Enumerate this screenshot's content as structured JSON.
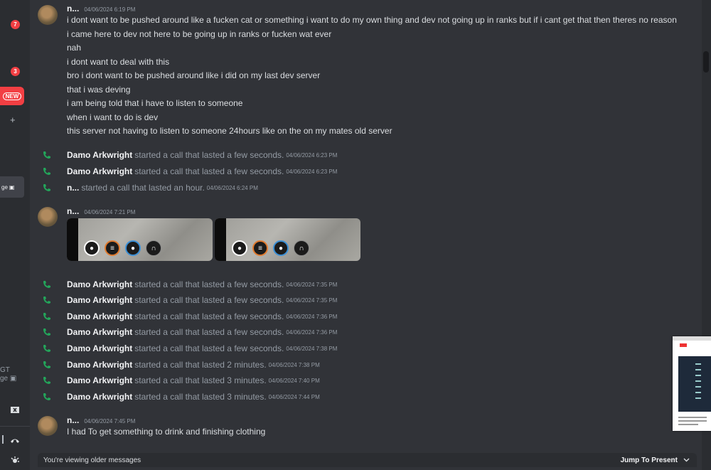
{
  "sidebar": {
    "badges": [
      "7",
      "3"
    ],
    "new_label": "NEW",
    "add_icon": "+",
    "dm_label": "ge",
    "bottom_label_1": "GT",
    "bottom_label_2": "ge"
  },
  "messages": {
    "group1": {
      "author": "n...",
      "timestamp": "04/06/2024 6:19 PM",
      "lines": [
        "i dont want to be pushed around like a fucken cat or something i want to do my own thing and dev not going up in ranks but if i cant get that then theres no reason",
        "i came here to dev not here to be going up in ranks or fucken wat ever",
        "nah",
        "i dont want to deal with this",
        "bro i dont want to be pushed around like i did on my last dev server",
        "that i was deving",
        "i am being told that i have to listen to someone",
        "when i want to do is dev",
        "this server not having to listen to someone 24hours like on the on my mates old server"
      ]
    },
    "calls1": [
      {
        "name": "Damo Arkwright",
        "text": "started a call that lasted a few seconds.",
        "time": "04/06/2024 6:23 PM"
      },
      {
        "name": "Damo Arkwright",
        "text": "started a call that lasted a few seconds.",
        "time": "04/06/2024 6:23 PM"
      },
      {
        "name": "n...",
        "text": "started a call that lasted an hour.",
        "time": "04/06/2024 6:24 PM"
      }
    ],
    "group2": {
      "author": "n...",
      "timestamp": "04/06/2024 7:21 PM"
    },
    "calls2": [
      {
        "name": "Damo Arkwright",
        "text": "started a call that lasted a few seconds.",
        "time": "04/06/2024 7:35 PM"
      },
      {
        "name": "Damo Arkwright",
        "text": "started a call that lasted a few seconds.",
        "time": "04/06/2024 7:35 PM"
      },
      {
        "name": "Damo Arkwright",
        "text": "started a call that lasted a few seconds.",
        "time": "04/06/2024 7:36 PM"
      },
      {
        "name": "Damo Arkwright",
        "text": "started a call that lasted a few seconds.",
        "time": "04/06/2024 7:36 PM"
      },
      {
        "name": "Damo Arkwright",
        "text": "started a call that lasted a few seconds.",
        "time": "04/06/2024 7:38 PM"
      },
      {
        "name": "Damo Arkwright",
        "text": "started a call that lasted 2 minutes.",
        "time": "04/06/2024 7:38 PM"
      },
      {
        "name": "Damo Arkwright",
        "text": "started a call that lasted 3 minutes.",
        "time": "04/06/2024 7:40 PM"
      },
      {
        "name": "Damo Arkwright",
        "text": "started a call that lasted 3 minutes.",
        "time": "04/06/2024 7:44 PM"
      }
    ],
    "group3": {
      "author": "n...",
      "timestamp": "04/06/2024 7:45 PM",
      "text": "I had To get something to drink and finishing clothing"
    }
  },
  "bottom_bar": {
    "notice": "You're viewing older messages",
    "jump_label": "Jump To Present"
  },
  "colors": {
    "background": "#313338",
    "call_green": "#23a55a",
    "badge_red": "#f23f43"
  }
}
